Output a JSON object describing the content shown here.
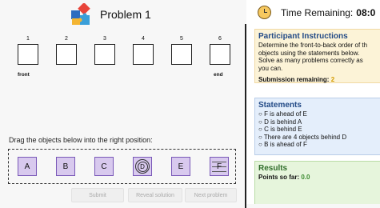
{
  "problem": {
    "title": "Problem 1"
  },
  "slots": {
    "numbers": [
      "1",
      "2",
      "3",
      "4",
      "5",
      "6"
    ],
    "front_label": "front",
    "end_label": "end"
  },
  "drag": {
    "instruction": "Drag the objects below into the right position:",
    "objects": [
      "A",
      "B",
      "C",
      "D",
      "E",
      "F"
    ]
  },
  "buttons": {
    "submit": "Submit",
    "reveal": "Reveal solution",
    "next": "Next problem"
  },
  "timer": {
    "label": "Time Remaining:",
    "value": "08:0"
  },
  "instructions": {
    "heading": "Participant Instructions",
    "lines": [
      "Determine the front-to-back order of th",
      "objects using the statements below.",
      "Solve as many problems correctly as",
      "you can."
    ],
    "submission_label": "Submission remaining:",
    "submission_value": "2"
  },
  "statements": {
    "heading": "Statements",
    "items": [
      "F is ahead of E",
      "D is behind A",
      "C is behind E",
      "There are 4 objects behind D",
      "B is ahead of F"
    ]
  },
  "results": {
    "heading": "Results",
    "points_label": "Points so far:",
    "points_value": "0.0"
  },
  "colors": {
    "object_fill": "#d8c9ee",
    "object_border": "#7a59b8",
    "submission_accent": "#d49b00",
    "points_accent": "#3a8a2f"
  }
}
